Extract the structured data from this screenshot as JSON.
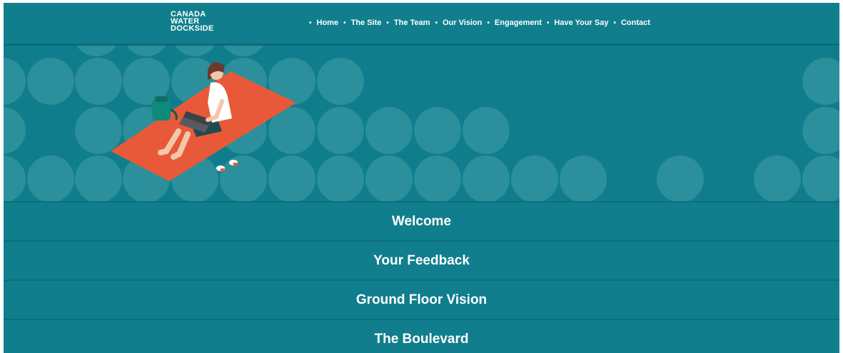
{
  "brand": {
    "logo_lines": [
      "CANADA",
      "WATER",
      "DOCKSIDE"
    ]
  },
  "nav": {
    "items": [
      "Home",
      "The Site",
      "The Team",
      "Our Vision",
      "Engagement",
      "Have Your Say",
      "Contact"
    ]
  },
  "hero": {
    "illustration": "person-on-picnic-blanket-with-laptop"
  },
  "sections": [
    {
      "label": "Welcome"
    },
    {
      "label": "Your Feedback"
    },
    {
      "label": "Ground Floor Vision"
    },
    {
      "label": "The Boulevard"
    }
  ],
  "colors": {
    "teal": "#0f7d8c",
    "circle": "#2b8f9c",
    "blanket": "#e8593a"
  }
}
